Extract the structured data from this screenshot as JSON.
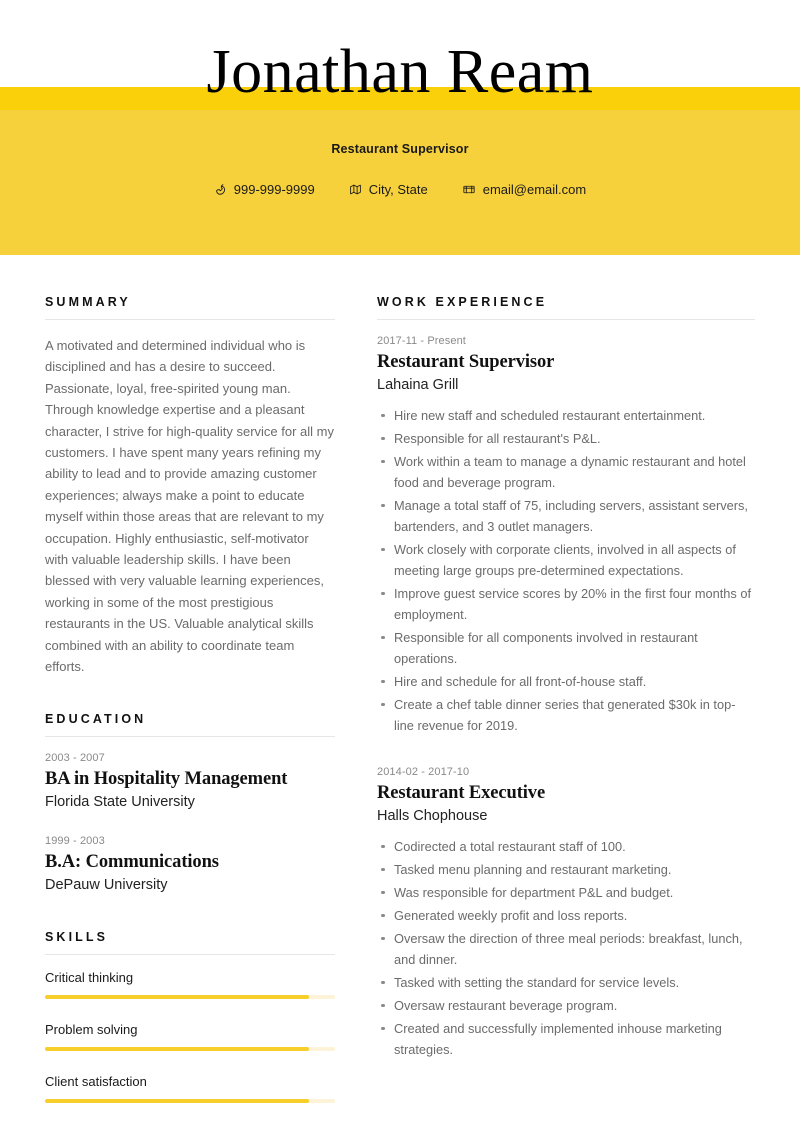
{
  "theme": {
    "accent": "#F7D13C",
    "accent_dark": "#F9D00A",
    "skill_fill": "#F8CE2B",
    "skill_track": "#FDF3D8",
    "text_body": "#6B6B6B",
    "text_heading": "#111111"
  },
  "header": {
    "name": "Jonathan Ream",
    "subtitle": "Restaurant Supervisor",
    "contacts": [
      {
        "icon": "phone-icon",
        "value": "999-999-9999"
      },
      {
        "icon": "map-icon",
        "value": "City, State"
      },
      {
        "icon": "envelope-icon",
        "value": "email@email.com"
      }
    ]
  },
  "left": {
    "summary": {
      "title": "Summary",
      "text": "A motivated and determined individual who is disciplined and has a desire to succeed. Passionate, loyal, free-spirited young man. Through knowledge expertise and a pleasant character, I strive for high-quality service for all my customers. I have spent many years refining my ability to lead and to provide amazing customer experiences; always make a point to educate myself within those areas that are relevant to my occupation. Highly enthusiastic, self-motivator with valuable leadership skills. I have been blessed with very valuable learning experiences, working in some of the most prestigious restaurants in the US. Valuable analytical skills combined with an ability to coordinate team efforts."
    },
    "education": {
      "title": "Education",
      "entries": [
        {
          "date": "2003 - 2007",
          "degree": "BA in Hospitality Management",
          "school": "Florida State University"
        },
        {
          "date": "1999 - 2003",
          "degree": "B.A: Communications",
          "school": "DePauw University"
        }
      ]
    },
    "skills": {
      "title": "Skills",
      "items": [
        {
          "name": "Critical thinking",
          "level": 91
        },
        {
          "name": "Problem solving",
          "level": 91
        },
        {
          "name": "Client satisfaction",
          "level": 91
        }
      ]
    }
  },
  "right": {
    "work": {
      "title": "Work Experience",
      "jobs": [
        {
          "date": "2017-11 - Present",
          "title": "Restaurant Supervisor",
          "company": "Lahaina Grill",
          "bullets": [
            "Hire new staff and scheduled restaurant entertainment.",
            "Responsible for all restaurant's P&L.",
            "Work within a team to manage a dynamic restaurant and hotel food and beverage program.",
            "Manage a total staff of 75, including servers, assistant servers, bartenders, and 3 outlet managers.",
            "Work closely with corporate clients, involved in all aspects of meeting large groups pre-determined expectations.",
            "Improve guest service scores by 20% in the first four months of employment.",
            "Responsible for all components involved in restaurant operations.",
            "Hire and schedule for all front-of-house staff.",
            "Create a chef table dinner series that generated $30k in top-line revenue for 2019."
          ]
        },
        {
          "date": "2014-02 - 2017-10",
          "title": "Restaurant Executive",
          "company": "Halls Chophouse",
          "bullets": [
            "Codirected a total restaurant staff of 100.",
            "Tasked menu planning and restaurant marketing.",
            "Was responsible for department P&L and budget.",
            "Generated weekly profit and loss reports.",
            "Oversaw the direction of three meal periods: breakfast, lunch, and dinner.",
            "Tasked with setting the standard for service levels.",
            "Oversaw restaurant beverage program.",
            "Created and successfully implemented inhouse marketing strategies."
          ]
        }
      ]
    }
  }
}
